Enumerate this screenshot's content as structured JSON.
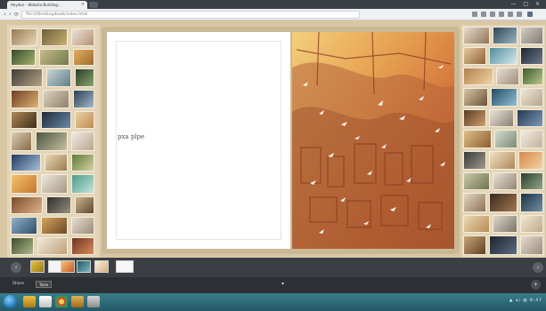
{
  "browser": {
    "tab_title": "Heydon - Website.Building...",
    "tab_close": "×",
    "window_controls": "— □ ×",
    "url": "file:///Desktop/book/index.html",
    "nav": {
      "back": "‹",
      "forward": "›",
      "reload": "⟳"
    }
  },
  "book": {
    "left_page_text": "pxa plpe",
    "right_page_image": "illustrated-page-birds-and-glyphs"
  },
  "controls": {
    "menu_label": "Share",
    "mode_box": "Table",
    "center_marker": "▾",
    "left_arrow": "‹",
    "right_arrow": "›",
    "zoom": "+"
  },
  "taskbar": {
    "tray_text": "▲ ◂) ▥ 8:47"
  },
  "colors": {
    "accent": "#d67235",
    "chrome": "#3a3f45",
    "background": "#d9c7a4"
  }
}
